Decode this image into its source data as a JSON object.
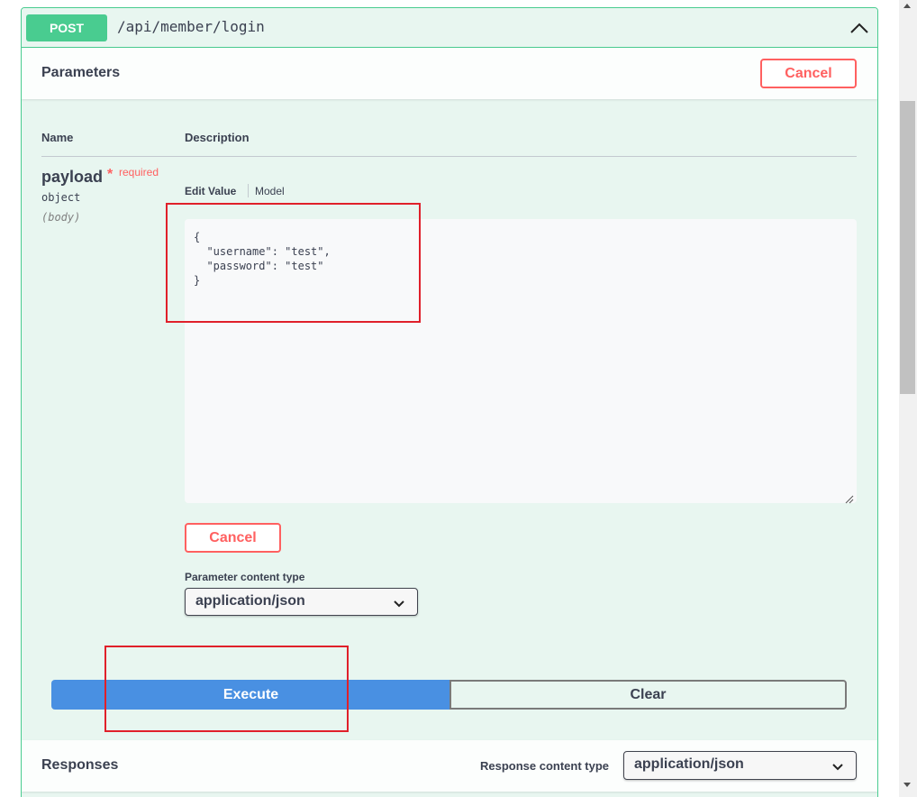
{
  "operation": {
    "method": "POST",
    "path": "/api/member/login",
    "method_color": "#49cc90"
  },
  "parameters": {
    "title": "Parameters",
    "cancel_label": "Cancel",
    "columns": {
      "name": "Name",
      "description": "Description"
    },
    "param": {
      "name": "payload",
      "required_star": "*",
      "required_label": "required",
      "type": "object",
      "in": "(body)"
    },
    "tabs": {
      "edit_value": "Edit Value",
      "model": "Model"
    },
    "body_value": "{\n  \"username\": \"test\",\n  \"password\": \"test\"\n}",
    "body_cancel_label": "Cancel",
    "content_type_label": "Parameter content type",
    "content_type_value": "application/json"
  },
  "actions": {
    "execute_label": "Execute",
    "clear_label": "Clear",
    "execute_color": "#4990e2"
  },
  "responses": {
    "title": "Responses",
    "content_type_label": "Response content type",
    "content_type_value": "application/json"
  },
  "icons": {
    "collapse": "chevron-up-icon",
    "dropdown": "chevron-down-icon",
    "resize": "resize-grip-icon"
  },
  "annotation_color": "#e0202a"
}
